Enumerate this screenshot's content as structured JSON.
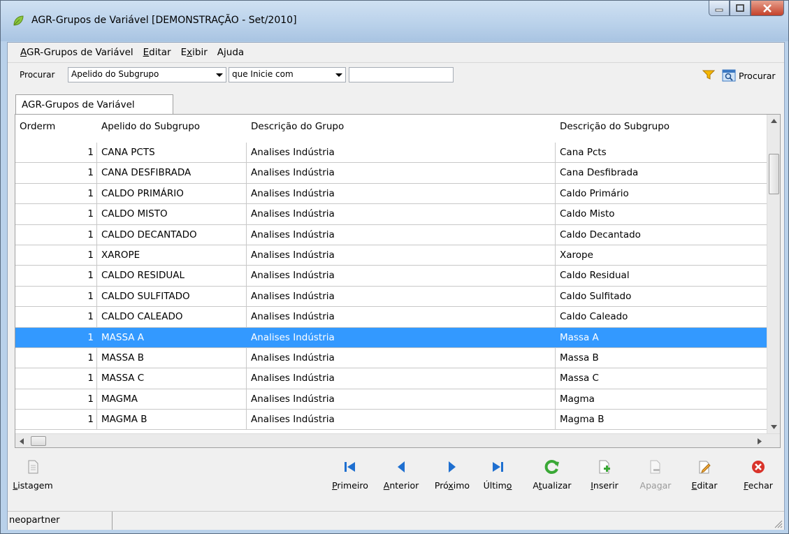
{
  "window": {
    "title": "AGR-Grupos de Variável [DEMONSTRAÇÃO - Set/2010]"
  },
  "menu": {
    "items": [
      "AGR-Grupos de Variável",
      "Editar",
      "Exibir",
      "Ajuda"
    ],
    "mnemonics": [
      "A",
      "E",
      "x",
      "j"
    ]
  },
  "search": {
    "label": "Procurar",
    "field": "Apelido do Subgrupo",
    "condition": "que Inicie com",
    "value": "",
    "button_label": "Procurar"
  },
  "tabs": [
    "AGR-Grupos de Variável"
  ],
  "grid": {
    "columns": [
      "Orderm",
      "Apelido do Subgrupo",
      "Descrição do Grupo",
      "Descrição do Subgrupo"
    ],
    "rows": [
      [
        "1",
        "CANA PCTS",
        "Analises Indústria",
        "Cana Pcts"
      ],
      [
        "1",
        "CANA DESFIBRADA",
        "Analises Indústria",
        "Cana Desfibrada"
      ],
      [
        "1",
        "CALDO PRIMÁRIO",
        "Analises Indústria",
        "Caldo Primário"
      ],
      [
        "1",
        "CALDO MISTO",
        "Analises Indústria",
        "Caldo Misto"
      ],
      [
        "1",
        "CALDO DECANTADO",
        "Analises Indústria",
        "Caldo Decantado"
      ],
      [
        "1",
        "XAROPE",
        "Analises Indústria",
        "Xarope"
      ],
      [
        "1",
        "CALDO RESIDUAL",
        "Analises Indústria",
        "Caldo Residual"
      ],
      [
        "1",
        "CALDO SULFITADO",
        "Analises Indústria",
        "Caldo Sulfitado"
      ],
      [
        "1",
        "CALDO CALEADO",
        "Analises Indústria",
        "Caldo Caleado"
      ],
      [
        "1",
        "MASSA A",
        "Analises Indústria",
        "Massa A"
      ],
      [
        "1",
        "MASSA B",
        "Analises Indústria",
        "Massa B"
      ],
      [
        "1",
        "MASSA C",
        "Analises Indústria",
        "Massa C"
      ],
      [
        "1",
        "MAGMA",
        "Analises Indústria",
        "Magma"
      ],
      [
        "1",
        "MAGMA B",
        "Analises Indústria",
        "Magma B"
      ]
    ],
    "selected_row": 9
  },
  "toolbar": {
    "listagem": "Listagem",
    "primeiro": "Primeiro",
    "anterior": "Anterior",
    "proximo": "Próximo",
    "ultimo": "Último",
    "atualizar": "Atualizar",
    "inserir": "Inserir",
    "apagar": "Apagar",
    "editar": "Editar",
    "fechar": "Fechar"
  },
  "status": {
    "user": "neopartner"
  },
  "colors": {
    "selection": "#3399ff",
    "nav_blue": "#1e6fd0",
    "refresh_green": "#3aa836",
    "close_red": "#d9332a"
  }
}
